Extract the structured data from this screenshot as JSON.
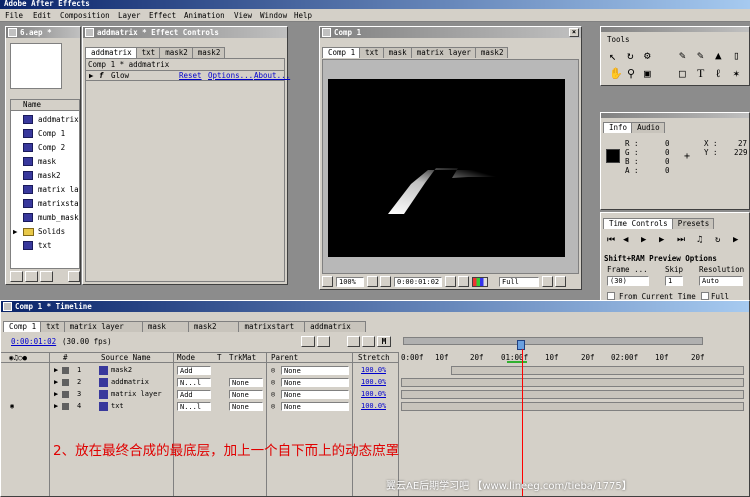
{
  "app": {
    "title": "Adobe After Effects"
  },
  "menu": [
    "File",
    "Edit",
    "Composition",
    "Layer",
    "Effect",
    "Animation",
    "View",
    "Window",
    "Help"
  ],
  "project": {
    "title": "6.aep *",
    "name_header": "Name",
    "items": [
      "addmatrix",
      "Comp 1",
      "Comp 2",
      "mask",
      "mask2",
      "matrix lay",
      "matrixstar",
      "mumb_mask",
      "Solids",
      "txt"
    ]
  },
  "effect_controls": {
    "title": "addmatrix * Effect Controls",
    "tabs": [
      "addmatrix",
      "txt",
      "mask2",
      "mask2"
    ],
    "header": "Comp 1 * addmatrix",
    "effect_name": "Glow",
    "reset": "Reset",
    "options": "Options...",
    "about": "About..."
  },
  "comp_window": {
    "title": "Comp 1",
    "tabs": [
      "Comp 1",
      "txt",
      "mask",
      "matrix layer",
      "mask2"
    ],
    "zoom": "100%",
    "timecode": "0:00:01:02",
    "resolution": "Full"
  },
  "tools": {
    "title": "Tools"
  },
  "info": {
    "tabs": [
      "Info",
      "Audio"
    ],
    "r_label": "R :",
    "r": "0",
    "g_label": "G :",
    "g": "0",
    "b_label": "B :",
    "b": "0",
    "a_label": "A :",
    "a": "0",
    "x_label": "X :",
    "x": "27",
    "y_label": "Y :",
    "y": "229"
  },
  "time_controls": {
    "tabs": [
      "Time Controls",
      "Presets"
    ],
    "ram_preview": "Shift+RAM Preview Options",
    "frame_rate_label": "Frame ...",
    "frame_rate": "(30)",
    "skip_label": "Skip",
    "skip": "1",
    "resolution_label": "Resolution",
    "resolution": "Auto",
    "from_current": "From Current Time",
    "full_screen": "Full S..."
  },
  "timeline": {
    "title": "Comp 1 * Timeline",
    "tabs": [
      "Comp 1",
      "txt",
      "matrix layer",
      "mask",
      "mask2",
      "matrixstart",
      "addmatrix"
    ],
    "timecode": "0:00:01:02",
    "fps": "(30.00 fps)",
    "columns": {
      "num": "#",
      "source": "Source Name",
      "mode": "Mode",
      "t": "T",
      "trkmat": "TrkMat",
      "parent": "Parent",
      "stretch": "Stretch"
    },
    "ruler": [
      "0:00f",
      "10f",
      "20f",
      "01:00f",
      "10f",
      "20f",
      "02:00f",
      "10f",
      "20f"
    ],
    "layers": [
      {
        "num": "1",
        "name": "mask2",
        "mode": "Add",
        "trkmat": "",
        "parent": "None",
        "stretch": "100.0%"
      },
      {
        "num": "2",
        "name": "addmatrix",
        "mode": "N...l",
        "trkmat": "None",
        "parent": "None",
        "stretch": "100.0%"
      },
      {
        "num": "3",
        "name": "matrix layer",
        "mode": "Add",
        "trkmat": "None",
        "parent": "None",
        "stretch": "100.0%"
      },
      {
        "num": "4",
        "name": "txt",
        "mode": "N...l",
        "trkmat": "None",
        "parent": "None",
        "stretch": "100.0%"
      }
    ]
  },
  "annotation": "2、放在最终合成的最底层，加上一个自下而上的动态庶罩",
  "watermark": "翼云AE后期学习吧 【www.lineeg.com/tieba/1775】",
  "colors": {
    "title_active": "#0a246a",
    "annotation": "#e00000",
    "time_marker": "#ff0000",
    "stretch": "#0000cc"
  }
}
